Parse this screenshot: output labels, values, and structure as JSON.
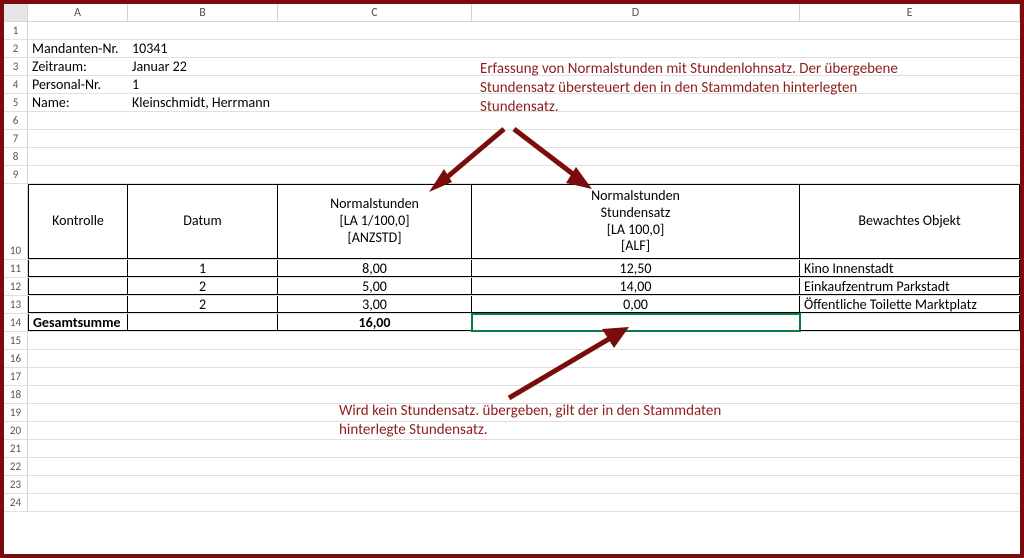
{
  "columns": [
    "A",
    "B",
    "C",
    "D",
    "E"
  ],
  "info": {
    "r2a": "Mandanten-Nr.",
    "r2b": "10341",
    "r3a": "Zeitraum:",
    "r3b": "Januar 22",
    "r4a": "Personal-Nr.",
    "r4b": "1",
    "r5a": "Name:",
    "r5b": "Kleinschmidt, Herrmann"
  },
  "tableHeaders": {
    "kontrolle": "Kontrolle",
    "datum": "Datum",
    "normalstunden": "Normalstunden\n[LA 1/100,0]\n[ANZSTD]",
    "stundensatz": "Normalstunden\nStundensatz\n[LA 100,0]\n[ALF]",
    "objekt": "Bewachtes Objekt"
  },
  "tableRows": [
    {
      "kontrolle": "",
      "datum": "1",
      "norm": "8,00",
      "satz": "12,50",
      "obj": "Kino Innenstadt"
    },
    {
      "kontrolle": "",
      "datum": "2",
      "norm": "5,00",
      "satz": "14,00",
      "obj": "Einkaufzentrum Parkstadt"
    },
    {
      "kontrolle": "",
      "datum": "2",
      "norm": "3,00",
      "satz": "0,00",
      "obj": "Öffentliche Toilette Marktplatz"
    }
  ],
  "sum": {
    "label": "Gesamtsumme",
    "value": "16,00"
  },
  "annotations": {
    "a1": "Erfassung von Normalstunden mit Stundenlohnsatz. Der übergebene Stundensatz übersteuert den in den Stammdaten hinterlegten Stundensatz.",
    "a2": "Wird kein Stundensatz. übergeben, gilt der in den Stammdaten hinterlegte Stundensatz."
  }
}
